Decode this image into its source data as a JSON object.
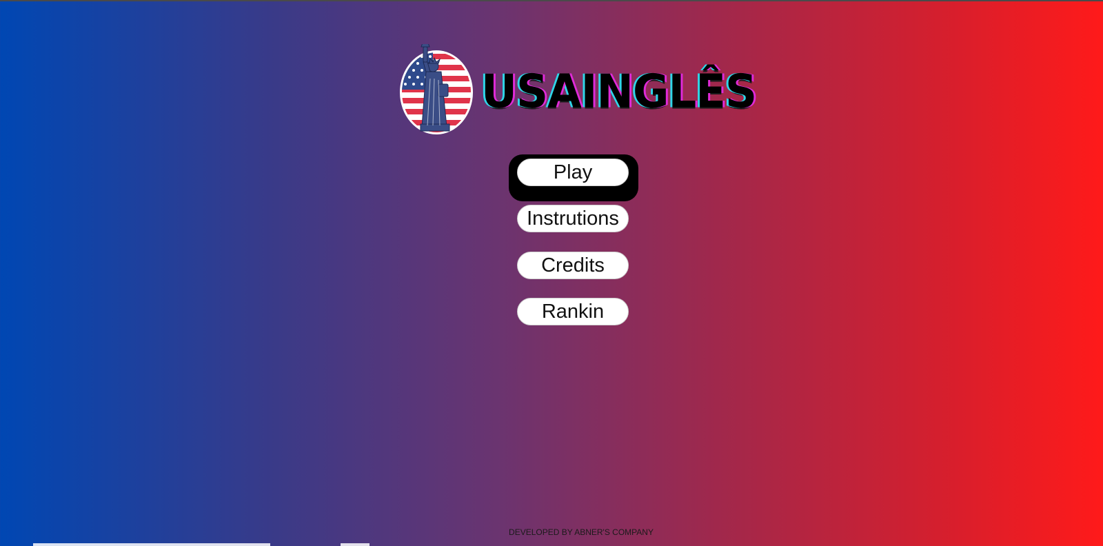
{
  "app": {
    "title": "USAINGLÊS"
  },
  "logo": {
    "emblem_icon": "statue-of-liberty-flag-emblem-icon",
    "text": "USAINGLÊS"
  },
  "menu": {
    "play_label": "Play",
    "instructions_label": "Instrutions",
    "credits_label": "Credits",
    "ranking_label": "Rankin"
  },
  "footer": {
    "text": "DEVELOPED BY ABNER'S COMPANY"
  },
  "colors": {
    "gradient_left": "#0047b3",
    "gradient_right": "#ff1a1a",
    "button_bg": "#ffffff",
    "focus_ring": "#000000",
    "logo_text_shadow_pink": "#e02ad8",
    "logo_text_shadow_cyan": "#2fd6e8"
  }
}
